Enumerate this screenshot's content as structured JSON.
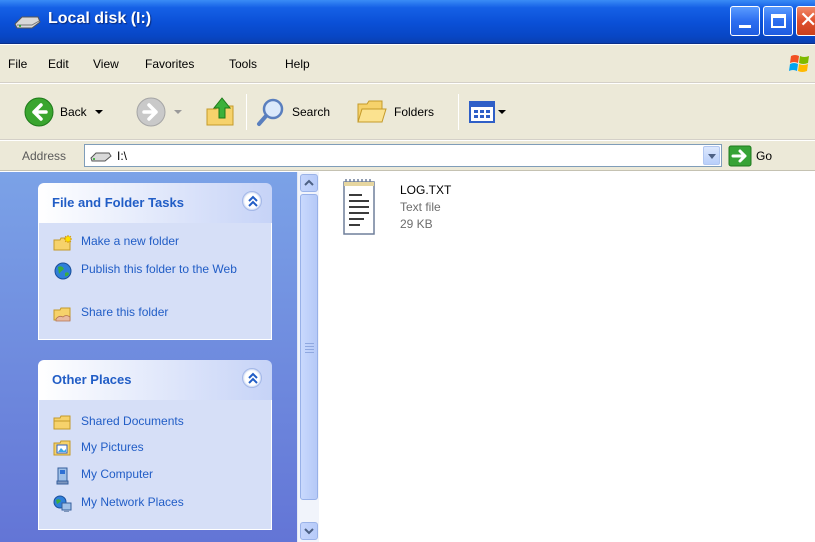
{
  "window": {
    "title": "Local disk (I:)",
    "drive_icon": "drive-icon",
    "controls": [
      "minimize-icon",
      "maximize-icon",
      "close-icon"
    ]
  },
  "menu": {
    "items": [
      "File",
      "Edit",
      "View",
      "Favorites",
      "Tools",
      "Help"
    ],
    "logo": "windows-flag-icon"
  },
  "toolbar": {
    "back_label": "Back",
    "search_label": "Search",
    "folders_label": "Folders",
    "icons": [
      "back-icon",
      "forward-icon",
      "up-folder-icon",
      "search-icon",
      "folders-icon",
      "views-icon"
    ]
  },
  "address": {
    "label": "Address",
    "value": "I:\\",
    "go_label": "Go"
  },
  "tasks_panel": {
    "title": "File and Folder Tasks",
    "items": [
      {
        "label": "Make a new folder",
        "icon": "new-folder-icon"
      },
      {
        "label": "Publish this folder to the Web",
        "icon": "publish-web-icon"
      },
      {
        "label": "Share this folder",
        "icon": "share-folder-icon"
      }
    ]
  },
  "places_panel": {
    "title": "Other Places",
    "items": [
      {
        "label": "Shared Documents",
        "icon": "folder-icon"
      },
      {
        "label": "My Pictures",
        "icon": "pictures-icon"
      },
      {
        "label": "My Computer",
        "icon": "computer-icon"
      },
      {
        "label": "My Network Places",
        "icon": "network-icon"
      }
    ]
  },
  "files": [
    {
      "name": "LOG.TXT",
      "type": "Text file",
      "size": "29 KB",
      "icon": "text-file-icon"
    }
  ],
  "colors": {
    "titlebar": "#0a4fd6",
    "taskpane_top": "#7ba2e7",
    "taskpane_bottom": "#6375d6",
    "link": "#215dc6",
    "panel_body": "#d6dff7",
    "chrome": "#ece9d8"
  }
}
